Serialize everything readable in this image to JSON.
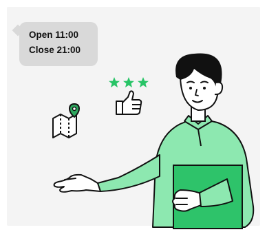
{
  "hours_bubble": {
    "open_text": "Open 11:00",
    "close_text": "Close 21:00"
  },
  "rating": {
    "stars": 3
  },
  "colors": {
    "background": "#f4f4f4",
    "bubble": "#d9d9d9",
    "sweater": "#8de8b0",
    "book": "#2ec36a",
    "star": "#27c466",
    "pin": "#2ea75e",
    "outline": "#111111"
  },
  "icons": [
    "map-icon",
    "location-pin-icon",
    "thumbs-up-icon",
    "star-icon"
  ]
}
